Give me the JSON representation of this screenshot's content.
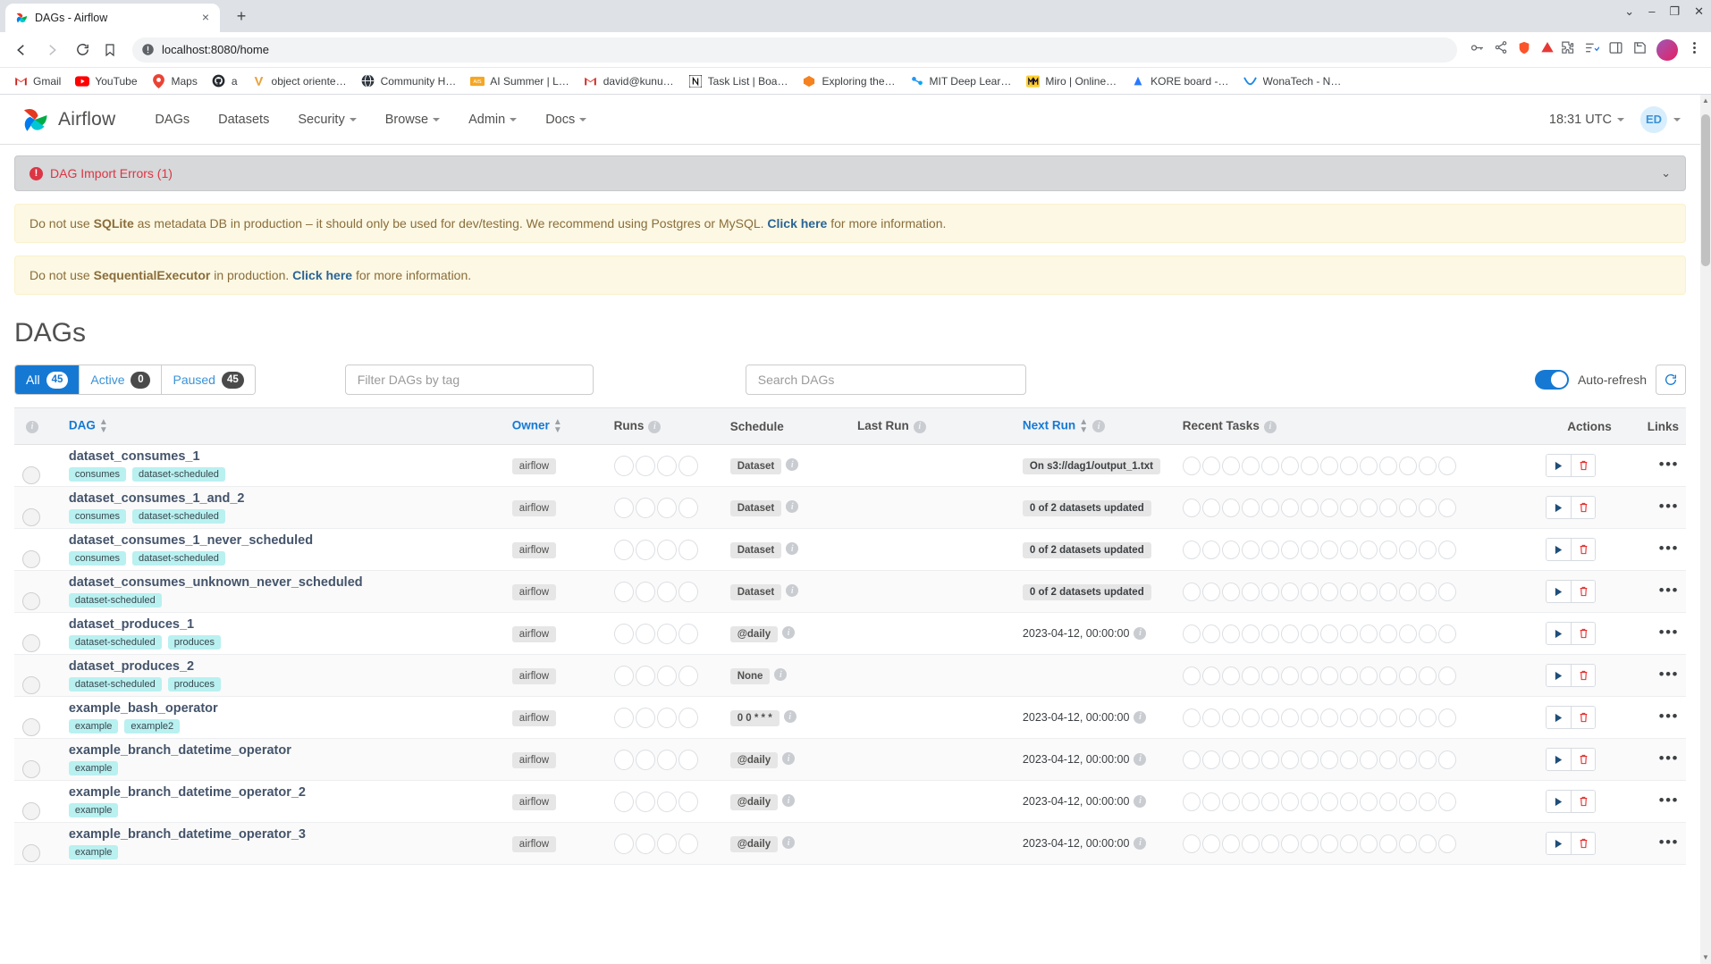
{
  "browser": {
    "tab": {
      "title": "DAGs - Airflow",
      "favicon": "airflow-pinwheel-icon",
      "close": "×"
    },
    "new_tab_label": "+",
    "window_controls": {
      "minimize": "–",
      "maximize": "❐",
      "close": "✕",
      "list": "⌄"
    },
    "nav": {
      "back": "◁",
      "forward": "▷",
      "reload": "↻"
    },
    "omnibox": {
      "url": "localhost:8080/home",
      "security_icon": "not-secure-info-icon",
      "bookmark_icon": "bookmark-icon"
    },
    "omnibox_right": {
      "password_icon": "key-icon",
      "share_icon": "share-icon",
      "shield_icon": "brave-shield-icon",
      "warn_icon": "triangle-warning-icon"
    },
    "toolbar_right": {
      "extensions": "puzzle-icon",
      "reading_list": "reading-list-icon",
      "sidebar": "sidebar-icon",
      "save": "save-icon",
      "profile": "profile-avatar",
      "menu": "kebab-menu-icon"
    },
    "bookmarks": [
      {
        "label": "Gmail",
        "icon": "gmail-icon"
      },
      {
        "label": "YouTube",
        "icon": "youtube-icon"
      },
      {
        "label": "Maps",
        "icon": "google-maps-icon"
      },
      {
        "label": "a",
        "icon": "github-icon"
      },
      {
        "label": "object oriente…",
        "icon": "v-icon"
      },
      {
        "label": "Community H…",
        "icon": "globe-icon"
      },
      {
        "label": "AI Summer | L…",
        "icon": "ais-icon"
      },
      {
        "label": "david@kunu…",
        "icon": "gmail-icon"
      },
      {
        "label": "Task List | Boa…",
        "icon": "notion-icon"
      },
      {
        "label": "Exploring the…",
        "icon": "orange-box-icon"
      },
      {
        "label": "MIT Deep Lear…",
        "icon": "mit-icon"
      },
      {
        "label": "Miro | Online…",
        "icon": "miro-icon"
      },
      {
        "label": "KORE board -…",
        "icon": "kore-icon"
      },
      {
        "label": "WonaTech - N…",
        "icon": "wonatech-icon"
      }
    ]
  },
  "airflow": {
    "brand": "Airflow",
    "menu": [
      {
        "label": "DAGs",
        "has_caret": false
      },
      {
        "label": "Datasets",
        "has_caret": false
      },
      {
        "label": "Security",
        "has_caret": true
      },
      {
        "label": "Browse",
        "has_caret": true
      },
      {
        "label": "Admin",
        "has_caret": true
      },
      {
        "label": "Docs",
        "has_caret": true
      }
    ],
    "clock": "18:31 UTC",
    "user_initials": "ED"
  },
  "alerts": {
    "import_errors": {
      "label": "DAG Import Errors (1)",
      "chevron": "⌄"
    },
    "sqlite": {
      "pre": "Do not use ",
      "bold": "SQLite",
      "mid": " as metadata DB in production – it should only be used for dev/testing. We recommend using Postgres or MySQL. ",
      "link": "Click here",
      "post": " for more information."
    },
    "executor": {
      "pre": "Do not use ",
      "bold": "SequentialExecutor",
      "mid": " in production. ",
      "link": "Click here",
      "post": " for more information."
    }
  },
  "page": {
    "title": "DAGs",
    "filters": [
      {
        "label": "All",
        "count": "45",
        "active": true
      },
      {
        "label": "Active",
        "count": "0",
        "active": false
      },
      {
        "label": "Paused",
        "count": "45",
        "active": false
      }
    ],
    "tag_filter_placeholder": "Filter DAGs by tag",
    "tag_filter_value": "",
    "search_placeholder": "Search DAGs",
    "search_value": "",
    "autorefresh_label": "Auto-refresh",
    "autorefresh_on": true,
    "refresh_icon": "refresh-icon"
  },
  "table": {
    "columns": [
      {
        "key": "pause",
        "label": "",
        "info": true,
        "sortable": false
      },
      {
        "key": "dag",
        "label": "DAG",
        "info": false,
        "sortable": true
      },
      {
        "key": "owner",
        "label": "Owner",
        "info": false,
        "sortable": true
      },
      {
        "key": "runs",
        "label": "Runs",
        "info": true,
        "sortable": false
      },
      {
        "key": "schedule",
        "label": "Schedule",
        "info": false,
        "sortable": false
      },
      {
        "key": "last_run",
        "label": "Last Run",
        "info": true,
        "sortable": false
      },
      {
        "key": "next_run",
        "label": "Next Run",
        "info": true,
        "sortable": true,
        "sorted": true
      },
      {
        "key": "recent_tasks",
        "label": "Recent Tasks",
        "info": true,
        "sortable": false
      },
      {
        "key": "actions",
        "label": "Actions",
        "info": false,
        "sortable": false
      },
      {
        "key": "links",
        "label": "Links",
        "info": false,
        "sortable": false
      }
    ],
    "actions": {
      "trigger": "trigger-dag-icon",
      "delete": "delete-dag-icon",
      "links": "•••"
    },
    "rows": [
      {
        "name": "dataset_consumes_1",
        "tags": [
          "consumes",
          "dataset-scheduled"
        ],
        "owner": "airflow",
        "schedule": "Dataset",
        "schedule_info": true,
        "last_run": "",
        "next_run": "On s3://dag1/output_1.txt",
        "next_run_type": "badge"
      },
      {
        "name": "dataset_consumes_1_and_2",
        "tags": [
          "consumes",
          "dataset-scheduled"
        ],
        "owner": "airflow",
        "schedule": "Dataset",
        "schedule_info": true,
        "last_run": "",
        "next_run": "0 of 2 datasets updated",
        "next_run_type": "badge"
      },
      {
        "name": "dataset_consumes_1_never_scheduled",
        "tags": [
          "consumes",
          "dataset-scheduled"
        ],
        "owner": "airflow",
        "schedule": "Dataset",
        "schedule_info": true,
        "last_run": "",
        "next_run": "0 of 2 datasets updated",
        "next_run_type": "badge"
      },
      {
        "name": "dataset_consumes_unknown_never_scheduled",
        "tags": [
          "dataset-scheduled"
        ],
        "owner": "airflow",
        "schedule": "Dataset",
        "schedule_info": true,
        "last_run": "",
        "next_run": "0 of 2 datasets updated",
        "next_run_type": "badge"
      },
      {
        "name": "dataset_produces_1",
        "tags": [
          "dataset-scheduled",
          "produces"
        ],
        "owner": "airflow",
        "schedule": "@daily",
        "schedule_info": true,
        "last_run": "",
        "next_run": "2023-04-12, 00:00:00",
        "next_run_type": "date"
      },
      {
        "name": "dataset_produces_2",
        "tags": [
          "dataset-scheduled",
          "produces"
        ],
        "owner": "airflow",
        "schedule": "None",
        "schedule_info": true,
        "last_run": "",
        "next_run": "",
        "next_run_type": "none"
      },
      {
        "name": "example_bash_operator",
        "tags": [
          "example",
          "example2"
        ],
        "owner": "airflow",
        "schedule": "0 0 * * *",
        "schedule_info": true,
        "last_run": "",
        "next_run": "2023-04-12, 00:00:00",
        "next_run_type": "date"
      },
      {
        "name": "example_branch_datetime_operator",
        "tags": [
          "example"
        ],
        "owner": "airflow",
        "schedule": "@daily",
        "schedule_info": true,
        "last_run": "",
        "next_run": "2023-04-12, 00:00:00",
        "next_run_type": "date"
      },
      {
        "name": "example_branch_datetime_operator_2",
        "tags": [
          "example"
        ],
        "owner": "airflow",
        "schedule": "@daily",
        "schedule_info": true,
        "last_run": "",
        "next_run": "2023-04-12, 00:00:00",
        "next_run_type": "date"
      },
      {
        "name": "example_branch_datetime_operator_3",
        "tags": [
          "example"
        ],
        "owner": "airflow",
        "schedule": "@daily",
        "schedule_info": true,
        "last_run": "",
        "next_run": "2023-04-12, 00:00:00",
        "next_run_type": "date"
      }
    ]
  },
  "colors": {
    "accent": "#1579d4",
    "danger": "#dc3545",
    "tag_bg": "#b9f0f0",
    "warn_bg": "#fcf8e3"
  }
}
